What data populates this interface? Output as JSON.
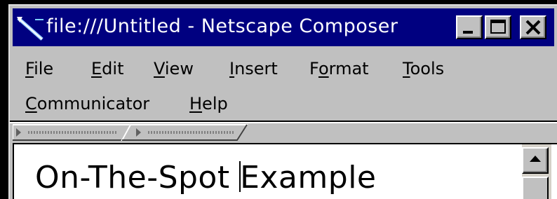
{
  "window": {
    "title": "file:///Untitled - Netscape Composer",
    "controls": {
      "minimize_icon": "minimize-icon",
      "maximize_icon": "maximize-icon",
      "close_icon": "close-icon"
    }
  },
  "menubar": {
    "items": [
      {
        "mnemonic": "F",
        "rest": "ile"
      },
      {
        "mnemonic": "E",
        "rest": "dit"
      },
      {
        "mnemonic": "V",
        "rest": "iew"
      },
      {
        "mnemonic": "I",
        "rest": "nsert"
      },
      {
        "pre": "F",
        "mnemonic": "o",
        "rest": "rmat"
      },
      {
        "mnemonic": "T",
        "rest": "ools"
      },
      {
        "mnemonic": "C",
        "rest": "ommunicator"
      },
      {
        "mnemonic": "H",
        "rest": "elp"
      }
    ]
  },
  "toolbar": {
    "collapsed_tab_icon": "collapsed-toolbar-tab-icon"
  },
  "editor": {
    "text_before_caret": "On-The-Spot ",
    "text_after_caret": "Example"
  },
  "colors": {
    "titlebar": "#000080",
    "title_text": "#ffffff",
    "chrome": "#c0c0c0",
    "editor_background": "#ffffff",
    "desktop": "#000000"
  }
}
